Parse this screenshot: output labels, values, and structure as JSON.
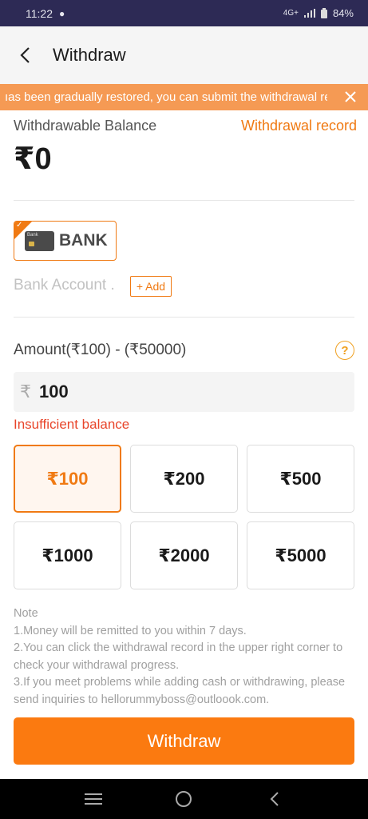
{
  "status_bar": {
    "time": "11:22",
    "network": "4G+",
    "battery": "84%"
  },
  "header": {
    "title": "Withdraw"
  },
  "notice": {
    "text": "ıas been gradually restored, you can submit the withdrawal re"
  },
  "balance": {
    "label": "Withdrawable Balance",
    "record_link": "Withdrawal record",
    "value": "₹0"
  },
  "payment_method": {
    "card_icon_text": "Bank",
    "label": "BANK",
    "selected": true
  },
  "bank_account": {
    "placeholder": "Bank Account .",
    "add_label": "+ Add"
  },
  "amount": {
    "label": "Amount(₹100) - (₹50000)",
    "currency_symbol": "₹",
    "value": "100",
    "error": "Insufficient balance",
    "help_glyph": "?"
  },
  "amount_options": [
    {
      "label": "₹100",
      "selected": true
    },
    {
      "label": "₹200",
      "selected": false
    },
    {
      "label": "₹500",
      "selected": false
    },
    {
      "label": "₹1000",
      "selected": false
    },
    {
      "label": "₹2000",
      "selected": false
    },
    {
      "label": "₹5000",
      "selected": false
    }
  ],
  "note": {
    "title": "Note",
    "lines": [
      "1.Money will be remitted to you within 7 days.",
      "2.You can click the withdrawal record in the upper right corner to check your withdrawal progress.",
      "3.If you meet problems while adding cash or withdrawing, please send inquiries to hellorummyboss@outloook.com."
    ]
  },
  "submit": {
    "label": "Withdraw"
  },
  "colors": {
    "accent": "#f07a13",
    "button": "#fb7a10",
    "notice_bg": "#f59a54",
    "error": "#e8452a",
    "status_bar": "#2d2a55"
  },
  "icons": {
    "back": "chevron-left-icon",
    "close": "close-icon",
    "help": "question-circle-icon",
    "card": "bank-card-icon",
    "nav_menu": "menu-icon",
    "nav_home": "home-circle-icon",
    "nav_back": "back-icon"
  }
}
